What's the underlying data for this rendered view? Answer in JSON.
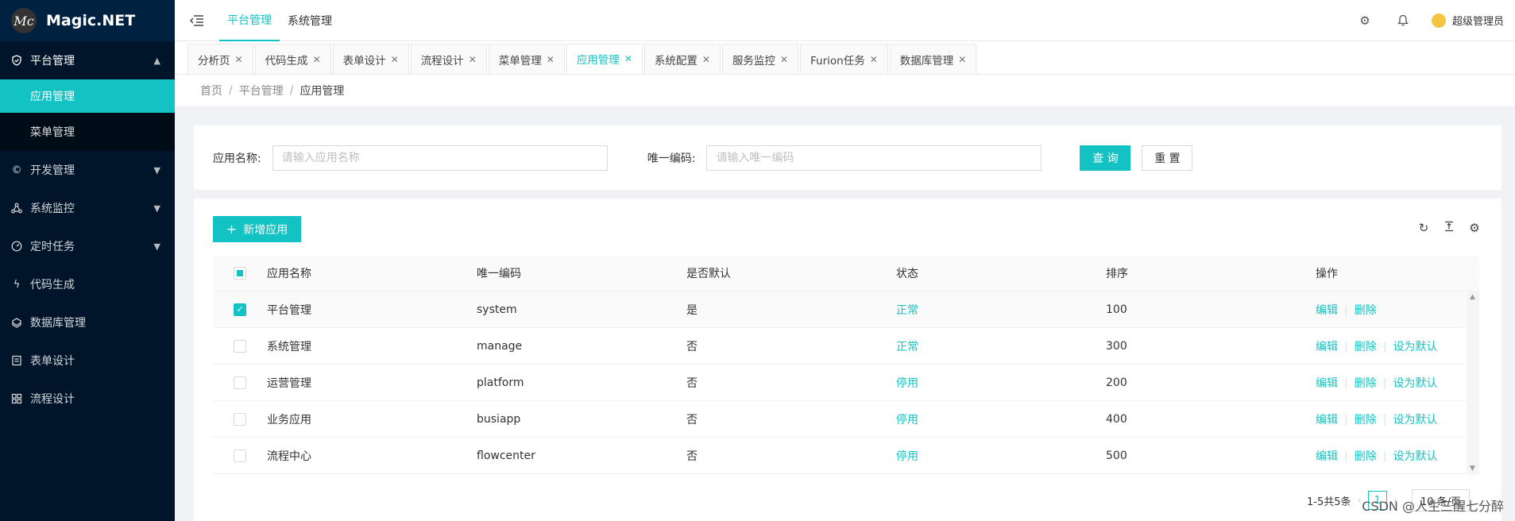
{
  "app": {
    "logo_mark": "Mc",
    "title": "Magic.NET"
  },
  "sidebar": {
    "groups": [
      {
        "label": "平台管理",
        "icon": "shield-icon",
        "expanded": true,
        "children": [
          {
            "label": "应用管理",
            "active": true
          },
          {
            "label": "菜单管理"
          }
        ]
      },
      {
        "label": "开发管理",
        "icon": "copyright-icon"
      },
      {
        "label": "系统监控",
        "icon": "cluster-icon"
      },
      {
        "label": "定时任务",
        "icon": "dashboard-icon"
      },
      {
        "label": "代码生成",
        "icon": "thunder-icon"
      },
      {
        "label": "数据库管理",
        "icon": "database-icon"
      },
      {
        "label": "表单设计",
        "icon": "form-icon"
      },
      {
        "label": "流程设计",
        "icon": "flow-icon"
      }
    ]
  },
  "header": {
    "tabs": [
      {
        "label": "平台管理",
        "active": true
      },
      {
        "label": "系统管理"
      }
    ],
    "user_name": "超级管理员"
  },
  "page_tabs": [
    {
      "label": "分析页"
    },
    {
      "label": "代码生成"
    },
    {
      "label": "表单设计"
    },
    {
      "label": "流程设计"
    },
    {
      "label": "菜单管理"
    },
    {
      "label": "应用管理",
      "active": true
    },
    {
      "label": "系统配置"
    },
    {
      "label": "服务监控"
    },
    {
      "label": "Furion任务"
    },
    {
      "label": "数据库管理"
    }
  ],
  "breadcrumb": {
    "items": [
      "首页",
      "平台管理",
      "应用管理"
    ]
  },
  "search": {
    "name_label": "应用名称:",
    "name_placeholder": "请输入应用名称",
    "code_label": "唯一编码:",
    "code_placeholder": "请输入唯一编码",
    "query_label": "查 询",
    "reset_label": "重 置"
  },
  "table": {
    "add_label": "新增应用",
    "columns": [
      "应用名称",
      "唯一编码",
      "是否默认",
      "状态",
      "排序",
      "操作"
    ],
    "rows": [
      {
        "name": "平台管理",
        "code": "system",
        "default": "是",
        "status": "正常",
        "sort": "100",
        "actions": [
          "编辑",
          "删除"
        ],
        "checked": true
      },
      {
        "name": "系统管理",
        "code": "manage",
        "default": "否",
        "status": "正常",
        "sort": "300",
        "actions": [
          "编辑",
          "删除",
          "设为默认"
        ],
        "checked": false
      },
      {
        "name": "运营管理",
        "code": "platform",
        "default": "否",
        "status": "停用",
        "sort": "200",
        "actions": [
          "编辑",
          "删除",
          "设为默认"
        ],
        "checked": false
      },
      {
        "name": "业务应用",
        "code": "busiapp",
        "default": "否",
        "status": "停用",
        "sort": "400",
        "actions": [
          "编辑",
          "删除",
          "设为默认"
        ],
        "checked": false
      },
      {
        "name": "流程中心",
        "code": "flowcenter",
        "default": "否",
        "status": "停用",
        "sort": "500",
        "actions": [
          "编辑",
          "删除",
          "设为默认"
        ],
        "checked": false
      }
    ]
  },
  "pagination": {
    "summary": "1-5共5条",
    "current_page": "1",
    "page_size": "10 条/页"
  },
  "watermark": "CSDN @人生三醒七分醉",
  "colors": {
    "accent": "#13c2c2",
    "sidebar_bg": "#001529",
    "sidebar_sub_bg": "#000c17"
  }
}
